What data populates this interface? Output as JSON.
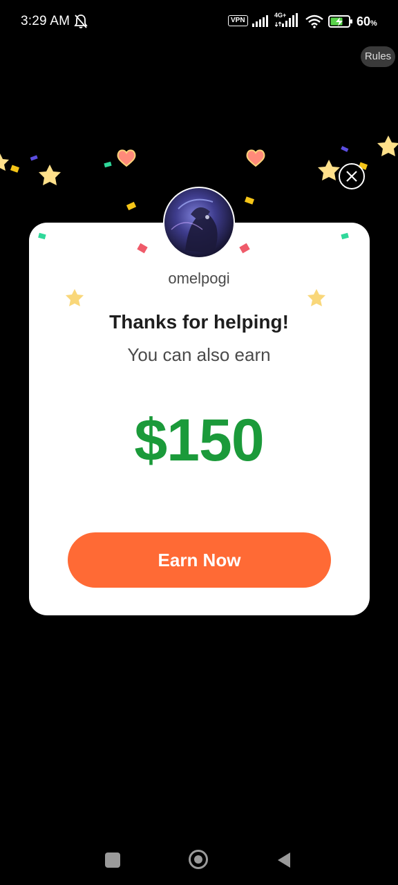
{
  "status_bar": {
    "time": "3:29 AM",
    "vpn_label": "VPN",
    "network_type": "4G+",
    "battery_percent": "60",
    "battery_unit": "%",
    "icons": [
      "bell-off-icon",
      "signal-icon",
      "wifi-icon",
      "battery-charging-icon"
    ]
  },
  "header": {
    "rules_label": "Rules"
  },
  "dialog": {
    "username": "omelpogi",
    "title": "Thanks for helping!",
    "subtitle": "You can also earn",
    "amount": "$150",
    "cta_label": "Earn Now",
    "close_icon": "close-icon",
    "colors": {
      "amount": "#1b9a3a",
      "cta_background": "#ff6a35",
      "card_background": "#ffffff"
    }
  },
  "navigation": {
    "icons": [
      "recents-icon",
      "home-icon",
      "back-icon"
    ]
  }
}
